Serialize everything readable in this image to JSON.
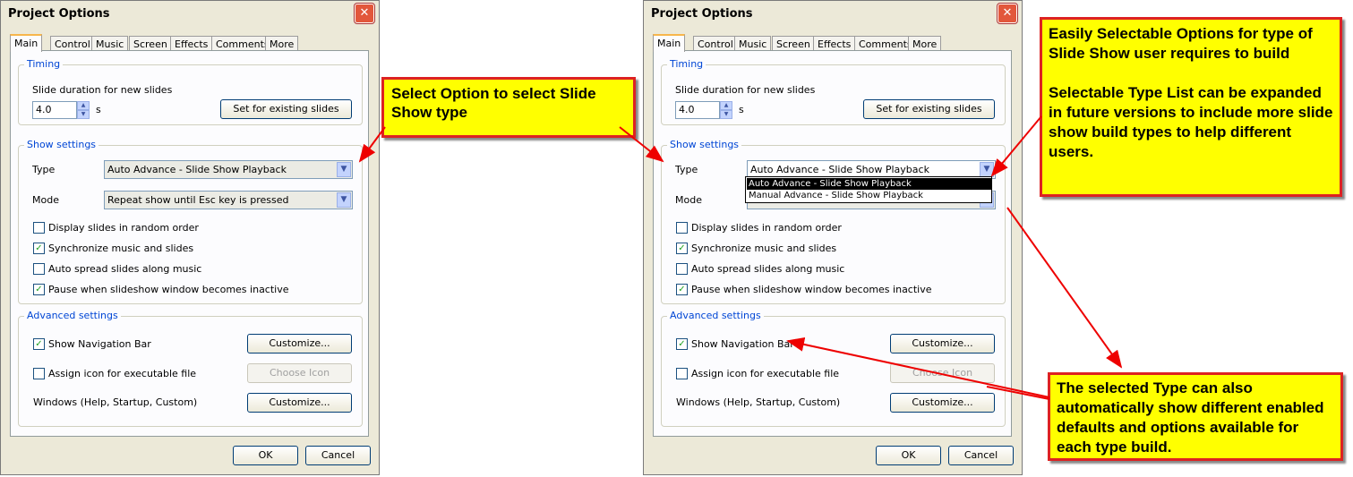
{
  "dialog": {
    "title": "Project Options",
    "close_glyph": "✕",
    "tabs": [
      "Main",
      "Control",
      "Music",
      "Screen",
      "Effects",
      "Comments",
      "More"
    ],
    "timing": {
      "group_title": "Timing",
      "duration_label": "Slide duration for new slides",
      "duration_value": "4.0",
      "duration_unit": "s",
      "set_existing_button": "Set for existing slides"
    },
    "show_settings": {
      "group_title": "Show settings",
      "type_label": "Type",
      "type_value": "Auto Advance - Slide Show Playback",
      "mode_label": "Mode",
      "mode_value": "Repeat show until Esc key is pressed",
      "options": [
        {
          "label": "Display slides in random order",
          "checked": false
        },
        {
          "label": "Synchronize music and slides",
          "checked": true
        },
        {
          "label": "Auto spread slides along music",
          "checked": false
        },
        {
          "label": "Pause when slideshow window becomes inactive",
          "checked": true
        }
      ]
    },
    "advanced_settings": {
      "group_title": "Advanced settings",
      "nav_bar_label": "Show Navigation Bar",
      "nav_bar_checked": true,
      "customize_button": "Customize...",
      "assign_icon_label": "Assign icon for executable file",
      "assign_icon_checked": false,
      "choose_icon_button": "Choose Icon",
      "windows_label": "Windows (Help, Startup, Custom)",
      "windows_customize_button": "Customize..."
    },
    "ok_button": "OK",
    "cancel_button": "Cancel",
    "check_glyph": "✓",
    "spin_up_glyph": "▲",
    "spin_down_glyph": "▼",
    "dropdown_glyph": "▼"
  },
  "type_dropdown": {
    "items": [
      "Auto Advance - Slide Show Playback",
      "Manual Advance - Slide Show Playback"
    ],
    "selected_index": 0
  },
  "callouts": {
    "select_option": "Select Option to select  Slide Show type",
    "selectable_options": "Easily Selectable Options for type of Slide Show user requires to build\n\nSelectable Type  List can be expanded in future versions to include more slide show build types to help different users.",
    "selected_type": "The selected Type can also automatically  show  different enabled defaults  and  options available for  each type build."
  },
  "colors": {
    "callout_fill": "#ffff00",
    "callout_border": "#dd2222",
    "arrow": "#ee0000",
    "group_title": "#0046d5",
    "active_tab_accent": "#f7b64c"
  }
}
